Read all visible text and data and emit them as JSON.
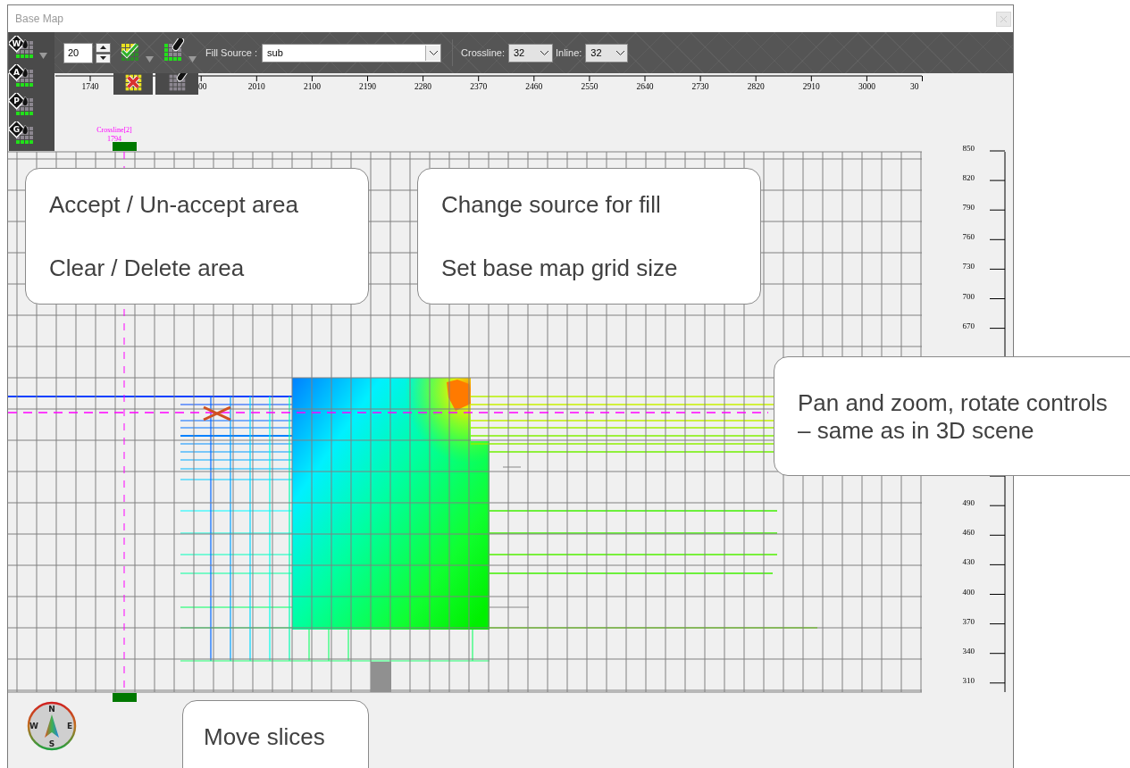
{
  "window": {
    "title": "Base Map"
  },
  "toolbar": {
    "tools": [
      {
        "letter": "W"
      },
      {
        "letter": "A"
      },
      {
        "letter": "P"
      },
      {
        "letter": "G"
      }
    ],
    "grid_step": {
      "value": "20"
    },
    "fill_source": {
      "label": "Fill Source :",
      "value": "sub"
    },
    "crossline": {
      "label": "Crossline:",
      "value": "32"
    },
    "inline": {
      "label": "Inline:",
      "value": "32"
    }
  },
  "map": {
    "x_ticks": [
      "1740",
      "00",
      "2010",
      "2100",
      "2190",
      "2280",
      "2370",
      "2460",
      "2550",
      "2640",
      "2730",
      "2820",
      "2910",
      "3000",
      "30"
    ],
    "y_ticks_upper": [
      "850",
      "820",
      "790",
      "760",
      "730",
      "700",
      "670"
    ],
    "y_ticks_lower": [
      "490",
      "460",
      "430",
      "400",
      "370",
      "340",
      "310"
    ],
    "crossline_marker": {
      "label": "Crossline[2]",
      "value": "1794"
    },
    "compass": [
      "N",
      "E",
      "S",
      "W"
    ]
  },
  "callouts": [
    {
      "lines": [
        "Accept / Un-accept area",
        "Clear / Delete area"
      ]
    },
    {
      "lines": [
        "Change source for fill",
        "Set base map grid size"
      ]
    },
    {
      "lines": [
        "Pan and zoom, rotate controls",
        "– same as in 3D scene"
      ]
    },
    {
      "lines": [
        "Move slices"
      ]
    }
  ]
}
